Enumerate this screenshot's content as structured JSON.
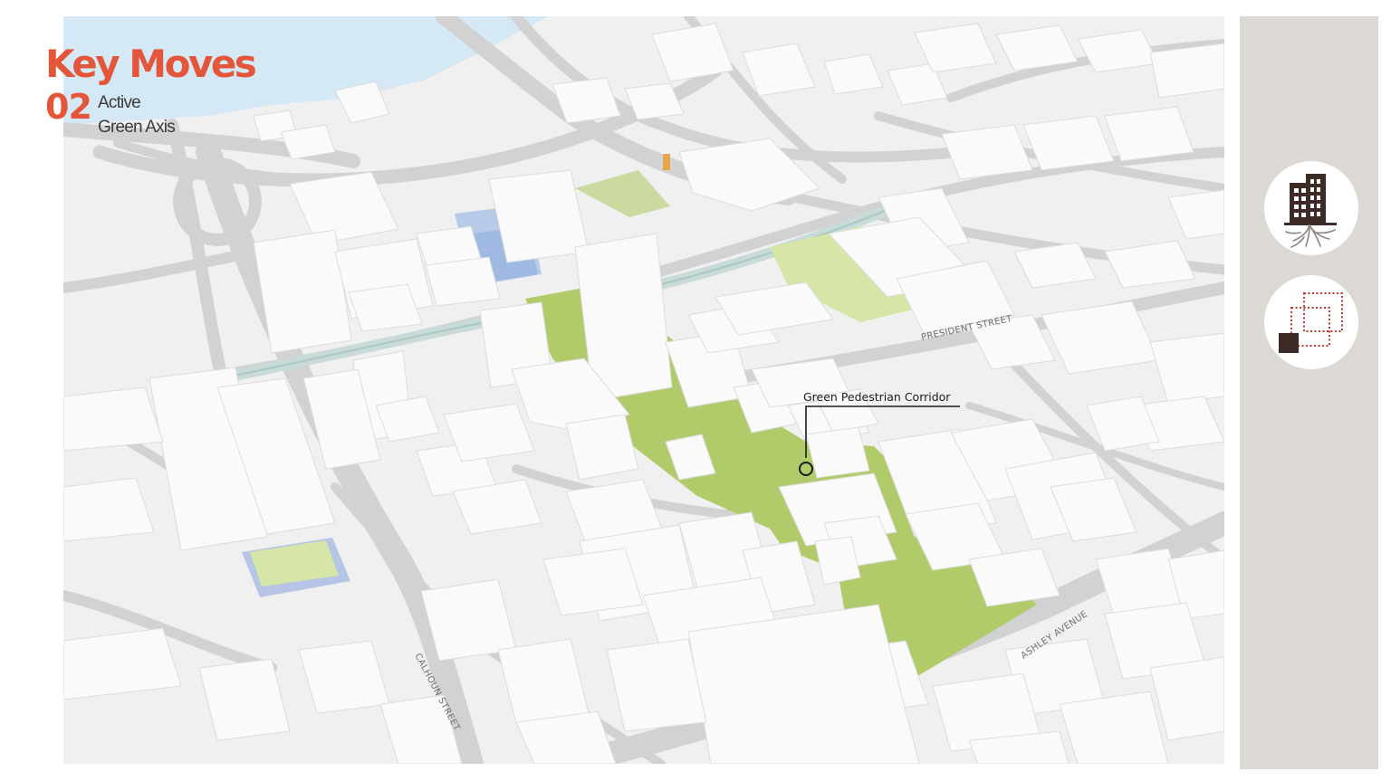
{
  "page": {
    "title": "Key Moves",
    "move_number": "02",
    "move_label_line1": "Active",
    "move_label_line2": "Green Axis"
  },
  "map": {
    "callout": "Green Pedestrian Corridor",
    "streets": {
      "president": "PRESIDENT STREET",
      "ashley": "ASHLEY AVENUE",
      "calhoun": "CALHOUN STREET"
    }
  },
  "side_panel": {
    "icons": [
      "building-roots-icon",
      "overlapping-squares-icon"
    ]
  },
  "colors": {
    "accent": "#e4563a",
    "corridor_green": "#b2cb6a",
    "side_panel": "#dcd9d5",
    "water": "#d5e8f5",
    "road": "#d2d2d2",
    "building": "#fafafa",
    "dark_square": "#3b2a26",
    "dotted_red": "#c0392b"
  }
}
